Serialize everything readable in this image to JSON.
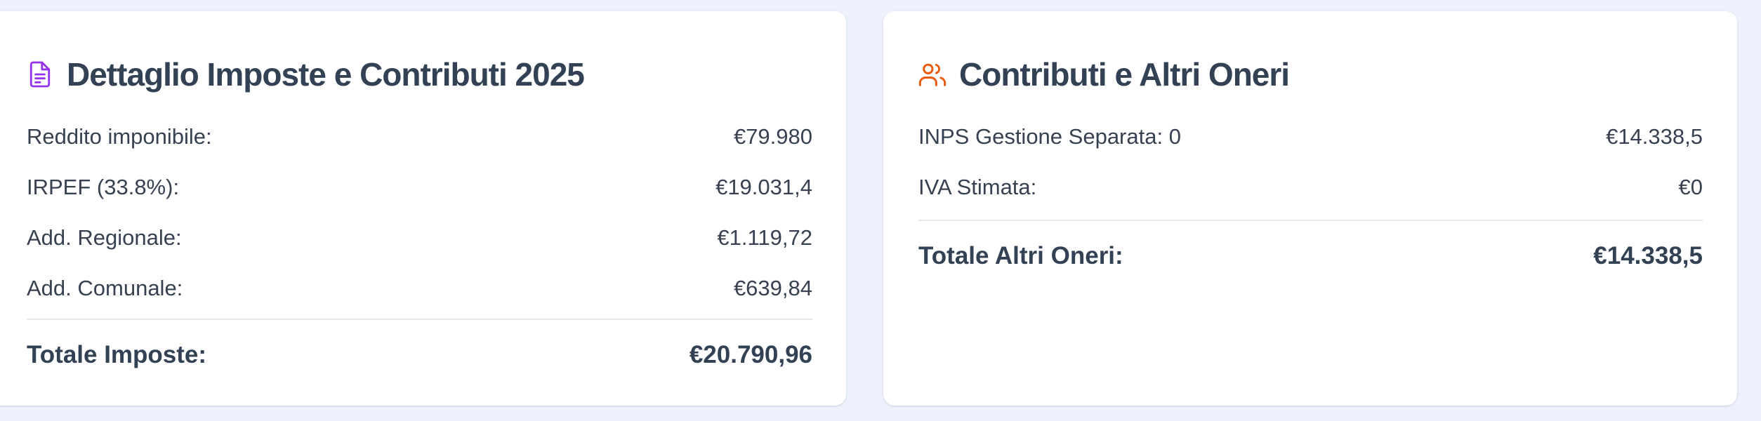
{
  "taxes_card": {
    "title": "Dettaglio Imposte e Contributi 2025",
    "icon": "document-icon",
    "icon_color": "#9333ea",
    "rows": [
      {
        "label": "Reddito imponibile:",
        "value": "€79.980"
      },
      {
        "label": "IRPEF (33.8%):",
        "value": "€19.031,4"
      },
      {
        "label": "Add. Regionale:",
        "value": "€1.119,72"
      },
      {
        "label": "Add. Comunale:",
        "value": "€639,84"
      }
    ],
    "total": {
      "label": "Totale Imposte:",
      "value": "€20.790,96"
    }
  },
  "contributions_card": {
    "title": "Contributi e Altri Oneri",
    "icon": "users-icon",
    "icon_color": "#ea580c",
    "rows": [
      {
        "label": "INPS Gestione Separata: 0",
        "value": "€14.338,5"
      },
      {
        "label": "IVA Stimata:",
        "value": "€0"
      }
    ],
    "total": {
      "label": "Totale Altri Oneri:",
      "value": "€14.338,5"
    }
  }
}
